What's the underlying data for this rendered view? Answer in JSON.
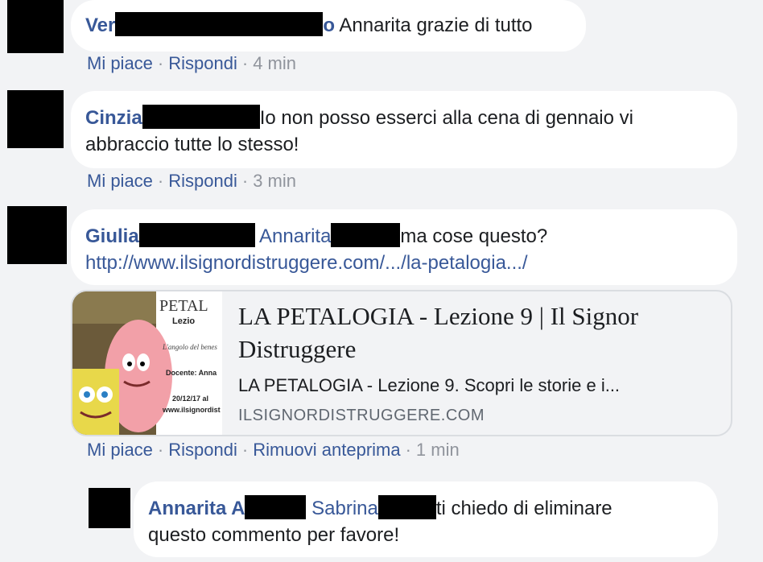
{
  "comments": [
    {
      "author": "Ver",
      "author_tail": "o",
      "text": "Annarita grazie di tutto",
      "actions": {
        "like": "Mi piace",
        "reply": "Rispondi",
        "time": "4 min"
      }
    },
    {
      "author": "Cinzia",
      "text_line1": "Io non posso esserci alla cena di gennaio vi",
      "text_line2": "abbraccio tutte lo stesso!",
      "actions": {
        "like": "Mi piace",
        "reply": "Rispondi",
        "time": "3 min"
      }
    },
    {
      "author": "Giulia",
      "mention": "Annarita",
      "text": "ma cose questo?",
      "link": "http://www.ilsignordistruggere.com/.../la-petalogia.../",
      "preview": {
        "title": "LA PETALOGIA - Lezione 9 | Il Signor Distruggere",
        "description": "LA PETALOGIA - Lezione 9. Scopri le storie e i...",
        "domain": "ILSIGNORDISTRUGGERE.COM",
        "thumb_lines": [
          "PETAL",
          "Lezio",
          "L'angolo del benes",
          "Docente: Anna",
          "20/12/17 al",
          "www.ilsignordist"
        ]
      },
      "actions": {
        "like": "Mi piace",
        "reply": "Rispondi",
        "remove_preview": "Rimuovi anteprima",
        "time": "1 min"
      }
    },
    {
      "author": "Annarita A",
      "mention": "Sabrina",
      "text_line1": "ti chiedo di eliminare",
      "text_line2": "questo commento per favore!"
    }
  ]
}
